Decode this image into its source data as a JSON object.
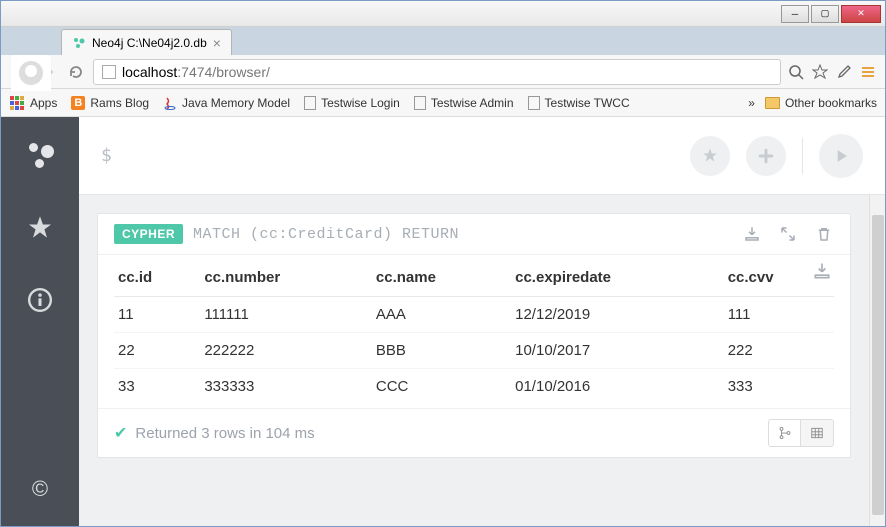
{
  "window": {
    "title": "Neo4j C:\\Ne04j2.0.db"
  },
  "browser": {
    "tab_title": "Neo4j C:\\Ne04j2.0.db",
    "url_host": "localhost",
    "url_path": ":7474/browser/"
  },
  "bookmarks": {
    "apps": "Apps",
    "items": [
      "Rams Blog",
      "Java Memory Model",
      "Testwise Login",
      "Testwise Admin",
      "Testwise TWCC"
    ],
    "overflow": "»",
    "other": "Other bookmarks"
  },
  "editor": {
    "prompt": "$"
  },
  "result": {
    "chip": "CYPHER",
    "query": "MATCH (cc:CreditCard) RETURN",
    "columns": [
      "cc.id",
      "cc.number",
      "cc.name",
      "cc.expiredate",
      "cc.cvv"
    ],
    "rows": [
      [
        "11",
        "111111",
        "AAA",
        "12/12/2019",
        "111"
      ],
      [
        "22",
        "222222",
        "BBB",
        "10/10/2017",
        "222"
      ],
      [
        "33",
        "333333",
        "CCC",
        "01/10/2016",
        "333"
      ]
    ],
    "status": "Returned 3 rows in 104 ms"
  },
  "sidebar": {
    "copyright": "©"
  }
}
